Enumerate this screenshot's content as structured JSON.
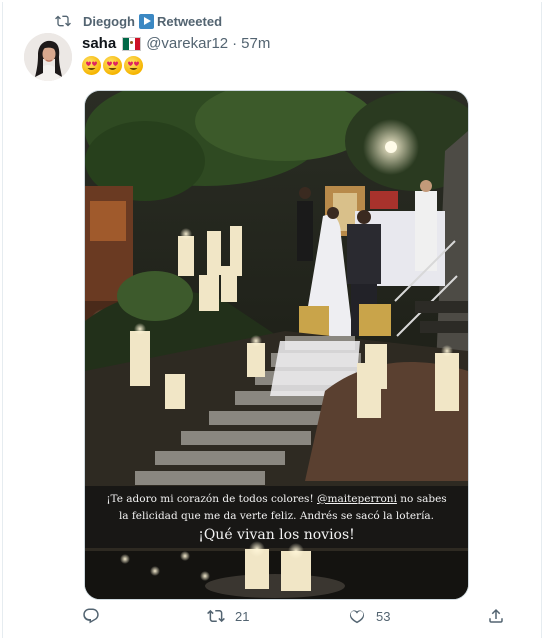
{
  "retweet": {
    "user": "Diegogh",
    "label": "Retweeted"
  },
  "tweet": {
    "name": "saha",
    "handle": "@varekar12",
    "separator": "·",
    "time": "57m",
    "text_emojis": "😍😍😍"
  },
  "media": {
    "caption_line1": "¡Te adoro mi corazón de todos colores! ",
    "caption_mention": "@maiteperroni",
    "caption_line1_rest": " no sabes",
    "caption_line2": "la felicidad que me da verte feliz. Andrés se sacó la lotería.",
    "caption_line3": "¡Qué vivan los novios!"
  },
  "actions": {
    "reply": "",
    "retweets": "21",
    "likes": "53"
  },
  "colors": {
    "muted": "#536471",
    "link": "#1d9bf0",
    "border": "#cfd9de",
    "flag_green": "#006847",
    "flag_red": "#ce1126"
  }
}
